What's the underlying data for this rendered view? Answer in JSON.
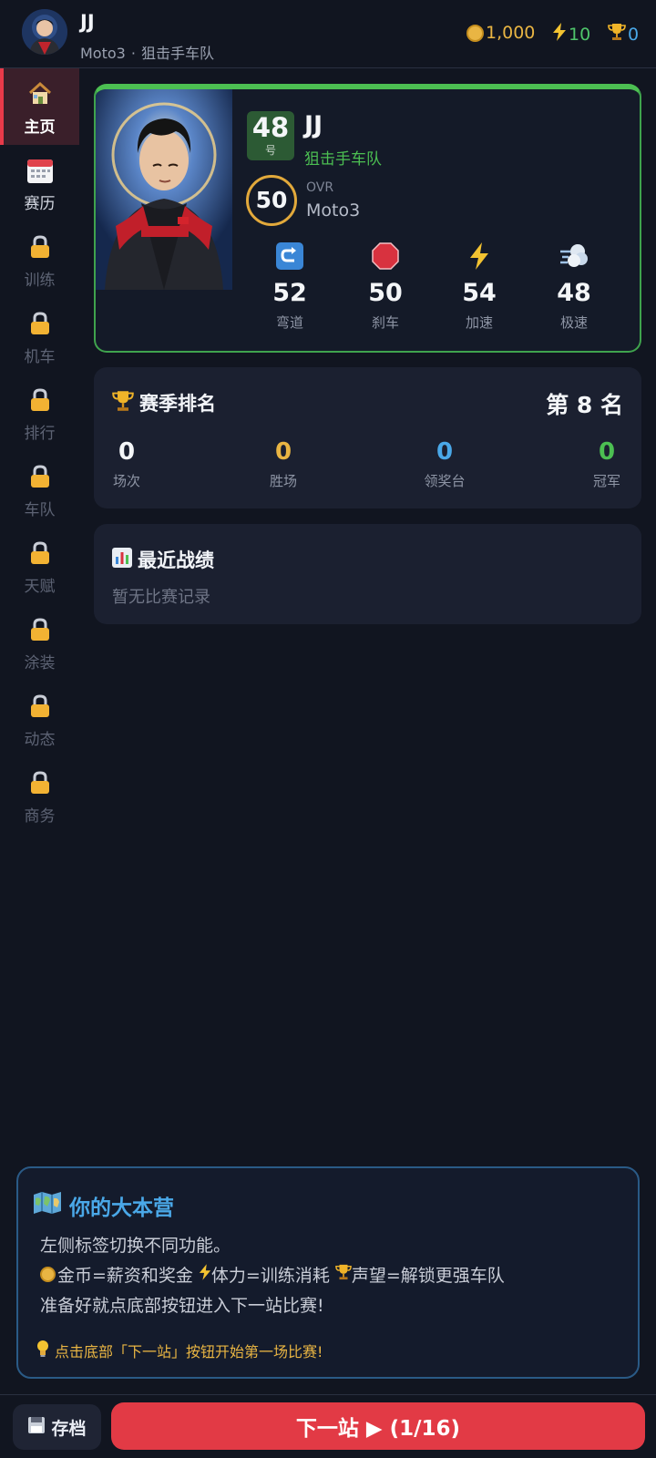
{
  "header": {
    "player_name": "JJ",
    "class": "Moto3",
    "separator": "·",
    "team": "狙击手车队",
    "coins": "1,000",
    "energy": "10",
    "reputation": "0"
  },
  "sidebar": {
    "items": [
      {
        "label": "主页",
        "icon": "house-icon",
        "state": "active"
      },
      {
        "label": "赛历",
        "icon": "calendar-icon",
        "state": "normal"
      },
      {
        "label": "训练",
        "icon": "lock-icon",
        "state": "locked"
      },
      {
        "label": "机车",
        "icon": "lock-icon",
        "state": "locked"
      },
      {
        "label": "排行",
        "icon": "lock-icon",
        "state": "locked"
      },
      {
        "label": "车队",
        "icon": "lock-icon",
        "state": "locked"
      },
      {
        "label": "天赋",
        "icon": "lock-icon",
        "state": "locked"
      },
      {
        "label": "涂装",
        "icon": "lock-icon",
        "state": "locked"
      },
      {
        "label": "动态",
        "icon": "lock-icon",
        "state": "locked"
      },
      {
        "label": "商务",
        "icon": "lock-icon",
        "state": "locked"
      }
    ]
  },
  "driver": {
    "number": "48",
    "number_suffix": "号",
    "name": "JJ",
    "team": "狙击手车队",
    "ovr": "50",
    "ovr_label": "OVR",
    "class": "Moto3",
    "stats": [
      {
        "label": "弯道",
        "value": "52",
        "icon": "corner-turn-icon"
      },
      {
        "label": "刹车",
        "value": "50",
        "icon": "stop-sign-icon"
      },
      {
        "label": "加速",
        "value": "54",
        "icon": "lightning-icon"
      },
      {
        "label": "极速",
        "value": "48",
        "icon": "wind-dash-icon"
      }
    ]
  },
  "season": {
    "title": "赛季排名",
    "rank": "第 8 名",
    "stats": [
      {
        "label": "场次",
        "value": "0",
        "color": "#f4f6f8"
      },
      {
        "label": "胜场",
        "value": "0",
        "color": "#e9b543"
      },
      {
        "label": "领奖台",
        "value": "0",
        "color": "#4aa8e8"
      },
      {
        "label": "冠军",
        "value": "0",
        "color": "#4cbf52"
      }
    ]
  },
  "recent": {
    "title": "最近战绩",
    "empty_text": "暂无比赛记录"
  },
  "intro": {
    "title": "你的大本营",
    "line1": "左侧标签切换不同功能。",
    "line2_coin": "金币=薪资和奖金",
    "line2_energy": "体力=训练消耗",
    "line2_trophy": "声望=解锁更强车队",
    "line3": "准备好就点底部按钮进入下一站比赛!",
    "tip": "点击底部「下一站」按钮开始第一场比赛!"
  },
  "bottom": {
    "save_label": "存档",
    "next_label": "下一站 ▶ (1/16)"
  },
  "colors": {
    "accent_green": "#4cbf52",
    "accent_red": "#e23a45",
    "gold": "#e9b543",
    "blue": "#4aa8e8"
  }
}
